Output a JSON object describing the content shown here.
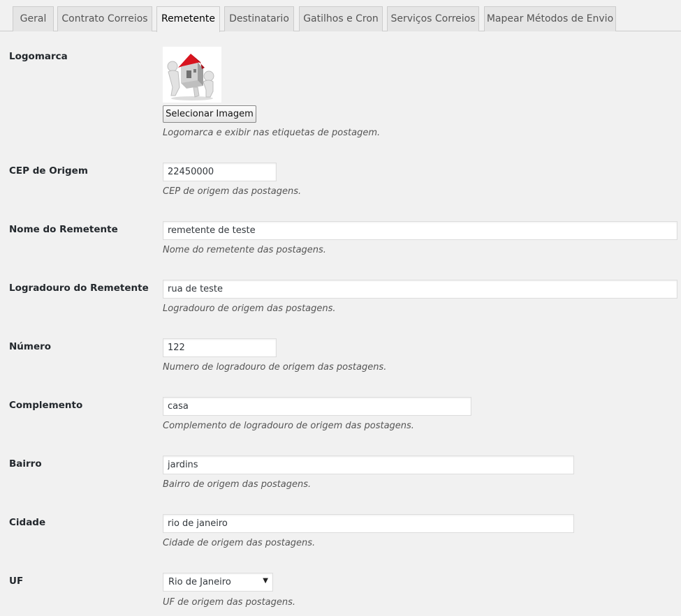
{
  "tabs": [
    {
      "label": "Geral"
    },
    {
      "label": "Contrato Correios"
    },
    {
      "label": "Remetente",
      "active": true
    },
    {
      "label": "Destinatario"
    },
    {
      "label": "Gatilhos e Cron"
    },
    {
      "label": "Serviços Correios"
    },
    {
      "label": "Mapear Métodos de Envio"
    }
  ],
  "logo": {
    "label": "Logomarca",
    "button_label": "Selecionar Imagem",
    "description": "Logomarca e exibir nas etiquetas de postagem.",
    "image_icon": "house-carried-by-figures-icon"
  },
  "fields": {
    "cep": {
      "label": "CEP de Origem",
      "value": "22450000",
      "description": "CEP de origem das postagens."
    },
    "nome": {
      "label": "Nome do Remetente",
      "value": "remetente de teste",
      "description": "Nome do remetente das postagens."
    },
    "logradouro": {
      "label": "Logradouro do Remetente",
      "value": "rua de teste",
      "description": "Logradouro de origem das postagens."
    },
    "numero": {
      "label": "Número",
      "value": "122",
      "description": "Numero de logradouro de origem das postagens."
    },
    "complemento": {
      "label": "Complemento",
      "value": "casa",
      "description": "Complemento de logradouro de origem das postagens."
    },
    "bairro": {
      "label": "Bairro",
      "value": "jardins",
      "description": "Bairro de origem das postagens."
    },
    "cidade": {
      "label": "Cidade",
      "value": "rio de janeiro",
      "description": "Cidade de origem das postagens."
    },
    "uf": {
      "label": "UF",
      "selected": "Rio de Janeiro",
      "description": "UF de origem das postagens."
    }
  }
}
